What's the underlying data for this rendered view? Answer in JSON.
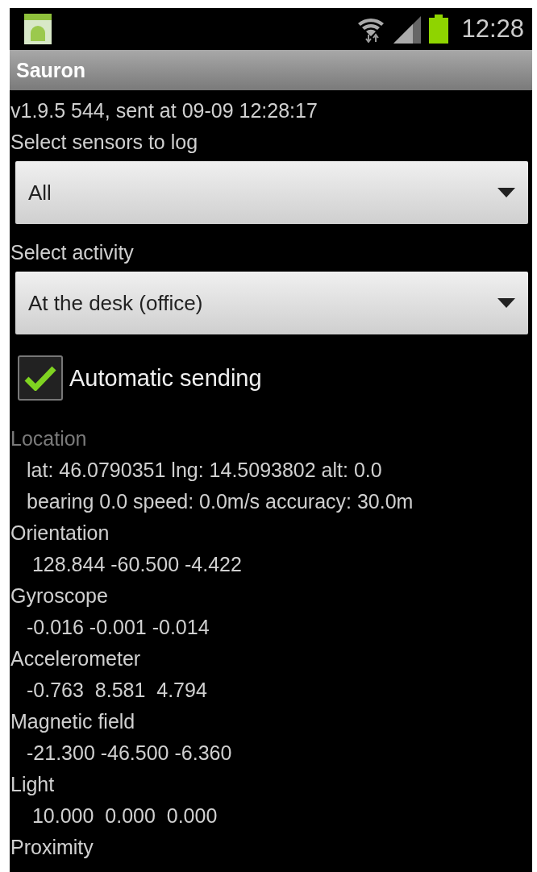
{
  "status_bar": {
    "time": "12:28"
  },
  "title_bar": {
    "title": "Sauron"
  },
  "version_line": "v1.9.5 544, sent at 09-09 12:28:17",
  "spinners": [
    {
      "label": "Select sensors to log",
      "value": "All"
    },
    {
      "label": "Select activity",
      "value": "At the desk (office)"
    }
  ],
  "auto_send": {
    "label": "Automatic sending",
    "checked": true
  },
  "sensors": [
    {
      "name": "Location",
      "disabled": true,
      "lines": [
        "lat: 46.0790351 lng: 14.5093802 alt: 0.0",
        "bearing 0.0 speed: 0.0m/s accuracy: 30.0m"
      ]
    },
    {
      "name": "Orientation",
      "disabled": false,
      "lines": [
        " 128.844 -60.500 -4.422"
      ]
    },
    {
      "name": "Gyroscope",
      "disabled": false,
      "lines": [
        "-0.016 -0.001 -0.014"
      ]
    },
    {
      "name": "Accelerometer",
      "disabled": false,
      "lines": [
        "-0.763  8.581  4.794"
      ]
    },
    {
      "name": "Magnetic field",
      "disabled": false,
      "lines": [
        "-21.300 -46.500 -6.360"
      ]
    },
    {
      "name": "Light",
      "disabled": false,
      "lines": [
        " 10.000  0.000  0.000"
      ]
    },
    {
      "name": "Proximity",
      "disabled": false
    }
  ]
}
